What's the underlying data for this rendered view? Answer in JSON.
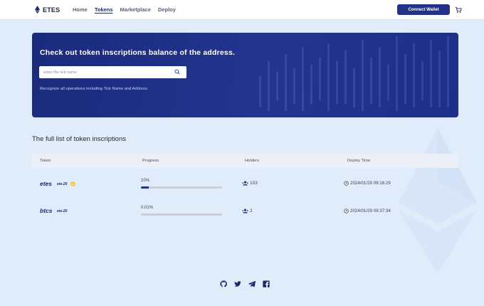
{
  "header": {
    "logo_text": "ETES",
    "nav": [
      "Home",
      "Tokens",
      "Marketplace",
      "Deploy"
    ],
    "active_nav": "Tokens",
    "connect_label": "Connect Wallet"
  },
  "hero": {
    "title": "Check out token inscriptions balance of the address.",
    "search_placeholder": "enter the tick name",
    "subtitle": "Recognize all operations including Tick Name and Address."
  },
  "list": {
    "title": "The full list of token inscriptions",
    "columns": [
      "Token",
      "Progress",
      "Holders",
      "Deploy Time"
    ],
    "rows": [
      {
        "tick": "etes",
        "standard": "ete-20",
        "verified": true,
        "progress_label": "10%",
        "progress": 0.1,
        "holders": "103",
        "deploy_time": "2024/01/29 09:16:29"
      },
      {
        "tick": "btcs",
        "standard": "ete-20",
        "verified": false,
        "progress_label": "0.01%",
        "progress": 0.0001,
        "holders": "2",
        "deploy_time": "2024/01/29 09:37:34"
      }
    ]
  },
  "footer": {
    "icons": [
      "github-icon",
      "twitter-icon",
      "telegram-icon",
      "facebook-icon"
    ]
  },
  "colors": {
    "accent": "#223287",
    "background": "#e1ecfb",
    "hero": "#1d2f86"
  }
}
